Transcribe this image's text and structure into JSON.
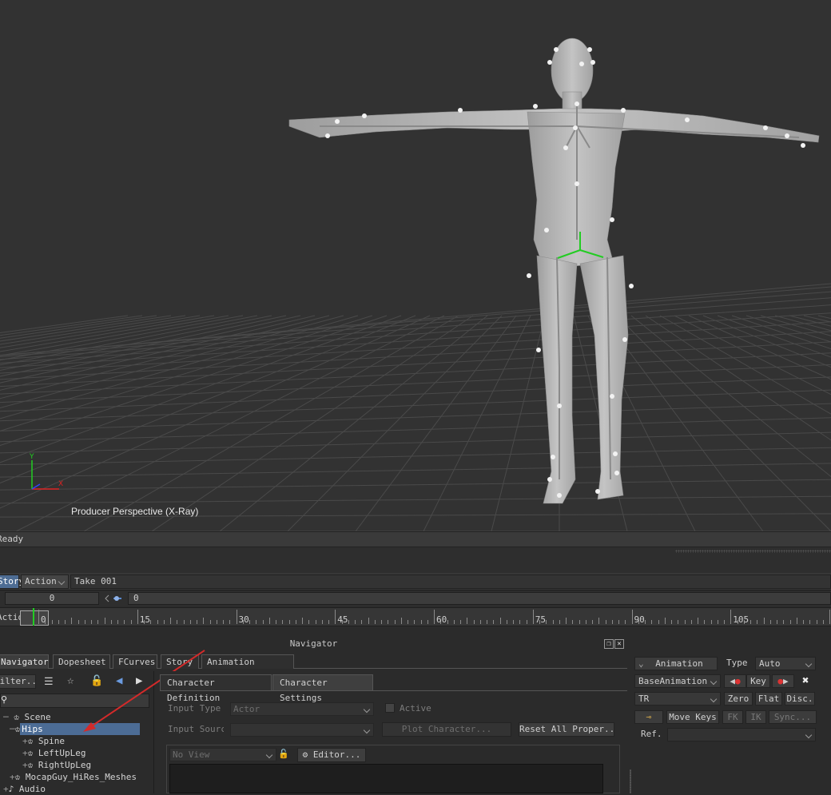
{
  "viewport": {
    "label": "Producer Perspective (X-Ray)",
    "axis_y": "Y",
    "axis_x": "X"
  },
  "status": {
    "text": "Ready"
  },
  "transport": {
    "story_btn": "Story",
    "action_btn": "Action",
    "take": "Take 001",
    "frame_start": "0",
    "frame_current": "0",
    "ruler_label": "Action",
    "ruler_marks": [
      "0",
      "15",
      "30",
      "45",
      "60",
      "75",
      "90",
      "105"
    ]
  },
  "navigator": {
    "title": "Navigator",
    "tabs": [
      "Navigator",
      "Dopesheet",
      "FCurves",
      "Story",
      "Animation Trigger"
    ],
    "filter_btn": "Filter...",
    "tree": [
      {
        "label": "Scene"
      },
      {
        "label": "Hips"
      },
      {
        "label": "Spine"
      },
      {
        "label": "LeftUpLeg"
      },
      {
        "label": "RightUpLeg"
      },
      {
        "label": "MocapGuy_HiRes_Meshes"
      },
      {
        "label": "Audio"
      }
    ]
  },
  "character": {
    "tabs": [
      "Character Definition",
      "Character Settings"
    ],
    "input_type_label": "Input Type",
    "input_type_value": "Actor",
    "active_label": "Active",
    "input_source_label": "Input Source",
    "plot_btn": "Plot Character...",
    "reset_btn": "Reset All Proper...",
    "view_dd": "No View",
    "editor_btn": "Editor..."
  },
  "keying": {
    "animation_btn": "Animation",
    "type_label": "Type",
    "type_value": "Auto",
    "layer_value": "BaseAnimation",
    "key_btn": "Key",
    "tr_value": "TR",
    "zero_btn": "Zero",
    "flat_btn": "Flat",
    "disc_btn": "Disc.",
    "move_keys_btn": "Move Keys",
    "fk_btn": "FK",
    "ik_btn": "IK",
    "sync_btn": "Sync...",
    "ref_label": "Ref."
  },
  "colors": {
    "selection": "#4c6c95",
    "annotation_arrow": "#d42a2a",
    "pivot_green": "#22cc22"
  }
}
